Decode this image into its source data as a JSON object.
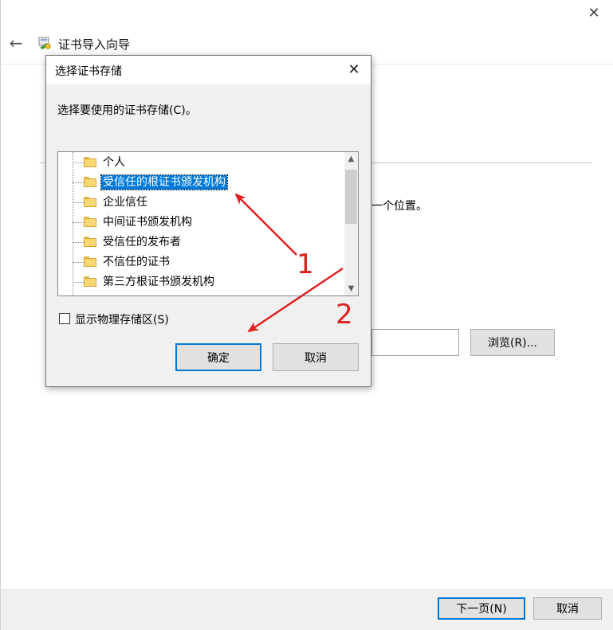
{
  "wizard": {
    "close_glyph": "✕",
    "back_glyph": "←",
    "title": "证书导入向导",
    "partial_text": "一个位置。",
    "browse_label": "浏览(R)...",
    "next_label": "下一页(N)",
    "cancel_label": "取消"
  },
  "dialog": {
    "title": "选择证书存储",
    "close_glyph": "✕",
    "prompt": "选择要使用的证书存储(C)。",
    "stores": [
      {
        "label": "个人",
        "selected": false
      },
      {
        "label": "受信任的根证书颁发机构",
        "selected": true
      },
      {
        "label": "企业信任",
        "selected": false
      },
      {
        "label": "中间证书颁发机构",
        "selected": false
      },
      {
        "label": "受信任的发布者",
        "selected": false
      },
      {
        "label": "不信任的证书",
        "selected": false
      },
      {
        "label": "第三方根证书颁发机构",
        "selected": false
      }
    ],
    "show_physical_label": "显示物理存储区(S)",
    "show_physical_checked": false,
    "ok_label": "确定",
    "cancel_label": "取消"
  },
  "annotations": {
    "label_1": "1",
    "label_2": "2",
    "color": "#e02020"
  },
  "colors": {
    "selection": "#0078d7",
    "focus_border": "#0078d7",
    "folder": "#f8d775"
  }
}
